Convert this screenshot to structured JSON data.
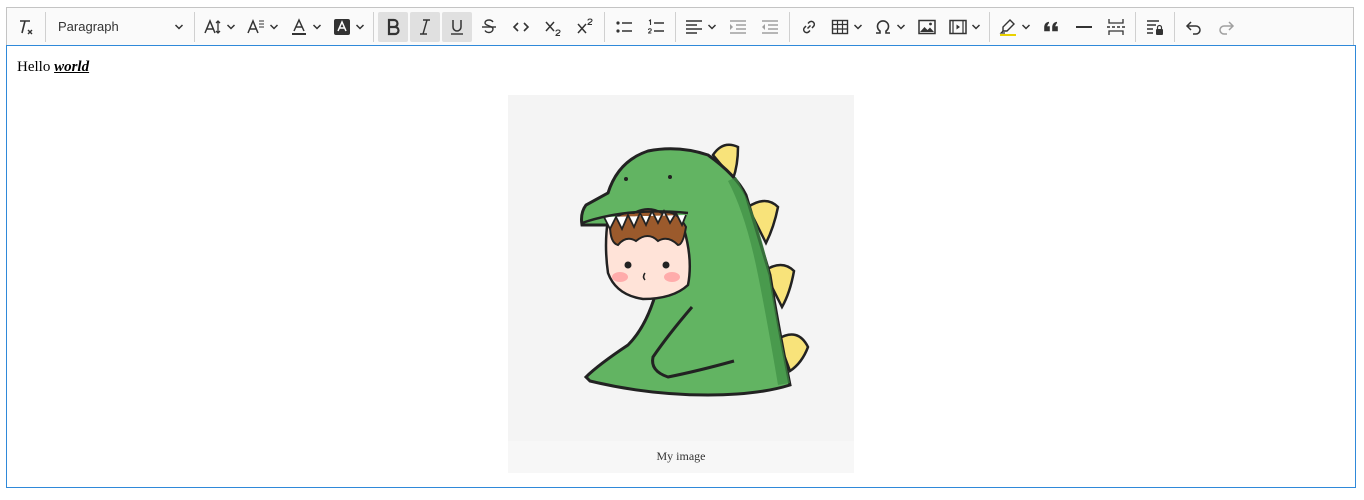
{
  "toolbar": {
    "heading_value": "Paragraph"
  },
  "content": {
    "text_plain": "Hello ",
    "text_emphasis": "world"
  },
  "image": {
    "caption": "My image"
  },
  "colors": {
    "focus_border": "#2f89d9",
    "dino_green": "#62b462",
    "dino_spike": "#f8e37a"
  }
}
